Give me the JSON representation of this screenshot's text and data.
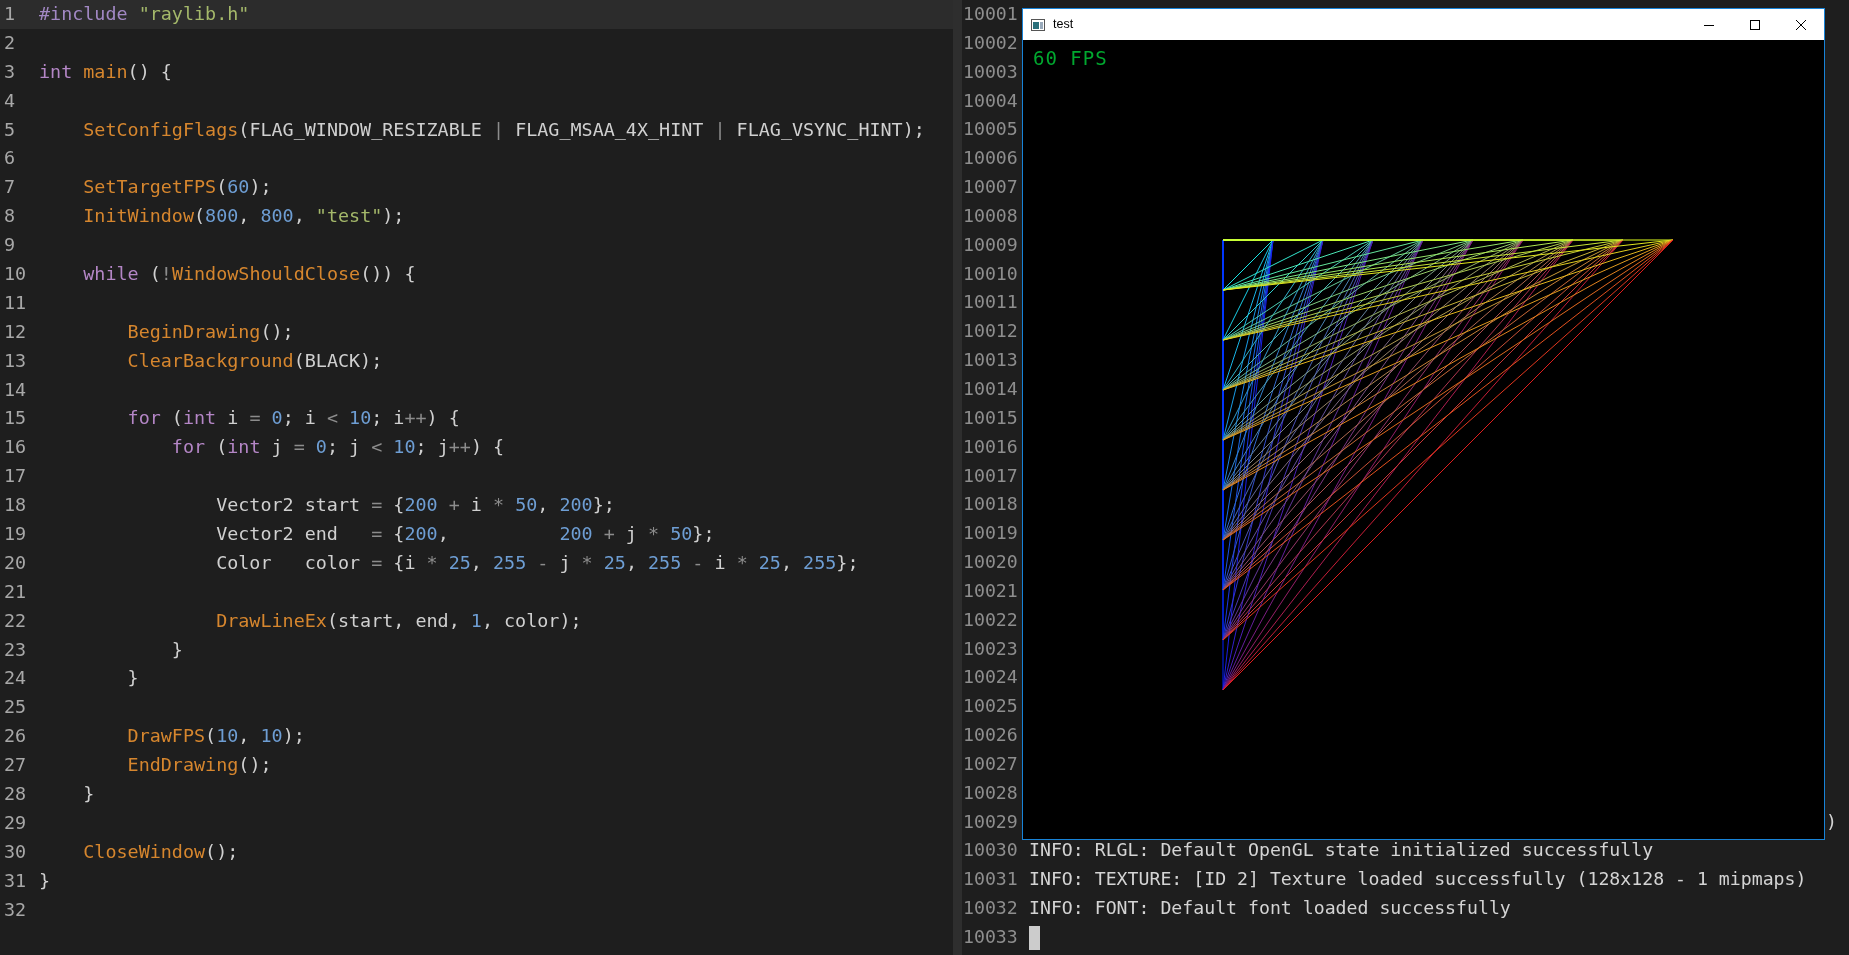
{
  "editor": {
    "lines": [
      {
        "number": "1",
        "current": true,
        "tokens": [
          {
            "kind": "preproc",
            "text": "#include"
          },
          {
            "kind": "string",
            "text": " \"raylib.h\""
          }
        ]
      },
      {
        "number": "2",
        "current": false
      },
      {
        "number": "3",
        "current": false,
        "tokens": [
          {
            "kind": "keyword",
            "text": "int"
          },
          {
            "kind": "func",
            "text": " main"
          },
          {
            "kind": "plain",
            "text": "() {"
          }
        ]
      },
      {
        "number": "4",
        "current": false
      },
      {
        "number": "5",
        "current": false,
        "tokens": [
          {
            "kind": "func",
            "text": "    SetConfigFlags"
          },
          {
            "kind": "plain",
            "text": "(FLAG_WINDOW_RESIZABLE "
          },
          {
            "kind": "op",
            "text": "|"
          },
          {
            "kind": "plain",
            "text": " FLAG_MSAA_4X_HINT "
          },
          {
            "kind": "op",
            "text": "|"
          },
          {
            "kind": "plain",
            "text": " FLAG_VSYNC_HINT);"
          }
        ]
      },
      {
        "number": "6",
        "current": false
      },
      {
        "number": "7",
        "current": false,
        "tokens": [
          {
            "kind": "func",
            "text": "    SetTargetFPS"
          },
          {
            "kind": "plain",
            "text": "("
          },
          {
            "kind": "number",
            "text": "60"
          },
          {
            "kind": "plain",
            "text": ");"
          }
        ]
      },
      {
        "number": "8",
        "current": false,
        "tokens": [
          {
            "kind": "func",
            "text": "    InitWindow"
          },
          {
            "kind": "plain",
            "text": "("
          },
          {
            "kind": "number",
            "text": "800"
          },
          {
            "kind": "plain",
            "text": ", "
          },
          {
            "kind": "number",
            "text": "800"
          },
          {
            "kind": "plain",
            "text": ", "
          },
          {
            "kind": "string",
            "text": "\"test\""
          },
          {
            "kind": "plain",
            "text": ");"
          }
        ]
      },
      {
        "number": "9",
        "current": false
      },
      {
        "number": "10",
        "current": false,
        "tokens": [
          {
            "kind": "keyword",
            "text": "    while"
          },
          {
            "kind": "plain",
            "text": " ("
          },
          {
            "kind": "op",
            "text": "!"
          },
          {
            "kind": "func",
            "text": "WindowShouldClose"
          },
          {
            "kind": "plain",
            "text": "()) {"
          }
        ]
      },
      {
        "number": "11",
        "current": false
      },
      {
        "number": "12",
        "current": false,
        "tokens": [
          {
            "kind": "func",
            "text": "        BeginDrawing"
          },
          {
            "kind": "plain",
            "text": "();"
          }
        ]
      },
      {
        "number": "13",
        "current": false,
        "tokens": [
          {
            "kind": "func",
            "text": "        ClearBackground"
          },
          {
            "kind": "plain",
            "text": "(BLACK);"
          }
        ]
      },
      {
        "number": "14",
        "current": false
      },
      {
        "number": "15",
        "current": false,
        "tokens": [
          {
            "kind": "keyword",
            "text": "        for"
          },
          {
            "kind": "plain",
            "text": " ("
          },
          {
            "kind": "keyword",
            "text": "int"
          },
          {
            "kind": "plain",
            "text": " i "
          },
          {
            "kind": "op",
            "text": "="
          },
          {
            "kind": "number",
            "text": " 0"
          },
          {
            "kind": "plain",
            "text": "; i "
          },
          {
            "kind": "op",
            "text": "<"
          },
          {
            "kind": "number",
            "text": " 10"
          },
          {
            "kind": "plain",
            "text": "; i"
          },
          {
            "kind": "op",
            "text": "++"
          },
          {
            "kind": "plain",
            "text": ") {"
          }
        ]
      },
      {
        "number": "16",
        "current": false,
        "tokens": [
          {
            "kind": "keyword",
            "text": "            for"
          },
          {
            "kind": "plain",
            "text": " ("
          },
          {
            "kind": "keyword",
            "text": "int"
          },
          {
            "kind": "plain",
            "text": " j "
          },
          {
            "kind": "op",
            "text": "="
          },
          {
            "kind": "number",
            "text": " 0"
          },
          {
            "kind": "plain",
            "text": "; j "
          },
          {
            "kind": "op",
            "text": "<"
          },
          {
            "kind": "number",
            "text": " 10"
          },
          {
            "kind": "plain",
            "text": "; j"
          },
          {
            "kind": "op",
            "text": "++"
          },
          {
            "kind": "plain",
            "text": ") {"
          }
        ]
      },
      {
        "number": "17",
        "current": false
      },
      {
        "number": "18",
        "current": false,
        "tokens": [
          {
            "kind": "plain",
            "text": "                Vector2 start "
          },
          {
            "kind": "op",
            "text": "="
          },
          {
            "kind": "plain",
            "text": " {"
          },
          {
            "kind": "number",
            "text": "200"
          },
          {
            "kind": "op",
            "text": " +"
          },
          {
            "kind": "plain",
            "text": " i "
          },
          {
            "kind": "op",
            "text": "*"
          },
          {
            "kind": "number",
            "text": " 50"
          },
          {
            "kind": "plain",
            "text": ", "
          },
          {
            "kind": "number",
            "text": "200"
          },
          {
            "kind": "plain",
            "text": "};"
          }
        ]
      },
      {
        "number": "19",
        "current": false,
        "tokens": [
          {
            "kind": "plain",
            "text": "                Vector2 end   "
          },
          {
            "kind": "op",
            "text": "="
          },
          {
            "kind": "plain",
            "text": " {"
          },
          {
            "kind": "number",
            "text": "200"
          },
          {
            "kind": "plain",
            "text": ",          "
          },
          {
            "kind": "number",
            "text": "200"
          },
          {
            "kind": "op",
            "text": " +"
          },
          {
            "kind": "plain",
            "text": " j "
          },
          {
            "kind": "op",
            "text": "*"
          },
          {
            "kind": "number",
            "text": " 50"
          },
          {
            "kind": "plain",
            "text": "};"
          }
        ]
      },
      {
        "number": "20",
        "current": false,
        "tokens": [
          {
            "kind": "plain",
            "text": "                Color   color "
          },
          {
            "kind": "op",
            "text": "="
          },
          {
            "kind": "plain",
            "text": " {i "
          },
          {
            "kind": "op",
            "text": "*"
          },
          {
            "kind": "number",
            "text": " 25"
          },
          {
            "kind": "plain",
            "text": ", "
          },
          {
            "kind": "number",
            "text": "255"
          },
          {
            "kind": "op",
            "text": " -"
          },
          {
            "kind": "plain",
            "text": " j "
          },
          {
            "kind": "op",
            "text": "*"
          },
          {
            "kind": "number",
            "text": " 25"
          },
          {
            "kind": "plain",
            "text": ", "
          },
          {
            "kind": "number",
            "text": "255"
          },
          {
            "kind": "op",
            "text": " -"
          },
          {
            "kind": "plain",
            "text": " i "
          },
          {
            "kind": "op",
            "text": "*"
          },
          {
            "kind": "number",
            "text": " 25"
          },
          {
            "kind": "plain",
            "text": ", "
          },
          {
            "kind": "number",
            "text": "255"
          },
          {
            "kind": "plain",
            "text": "};"
          }
        ]
      },
      {
        "number": "21",
        "current": false
      },
      {
        "number": "22",
        "current": false,
        "tokens": [
          {
            "kind": "func",
            "text": "                DrawLineEx"
          },
          {
            "kind": "plain",
            "text": "(start, end, "
          },
          {
            "kind": "number",
            "text": "1"
          },
          {
            "kind": "plain",
            "text": ", color);"
          }
        ]
      },
      {
        "number": "23",
        "current": false,
        "tokens": [
          {
            "kind": "plain",
            "text": "            }"
          }
        ]
      },
      {
        "number": "24",
        "current": false,
        "tokens": [
          {
            "kind": "plain",
            "text": "        }"
          }
        ]
      },
      {
        "number": "25",
        "current": false
      },
      {
        "number": "26",
        "current": false,
        "tokens": [
          {
            "kind": "func",
            "text": "        DrawFPS"
          },
          {
            "kind": "plain",
            "text": "("
          },
          {
            "kind": "number",
            "text": "10"
          },
          {
            "kind": "plain",
            "text": ", "
          },
          {
            "kind": "number",
            "text": "10"
          },
          {
            "kind": "plain",
            "text": ");"
          }
        ]
      },
      {
        "number": "27",
        "current": false,
        "tokens": [
          {
            "kind": "func",
            "text": "        EndDrawing"
          },
          {
            "kind": "plain",
            "text": "();"
          }
        ]
      },
      {
        "number": "28",
        "current": false,
        "tokens": [
          {
            "kind": "plain",
            "text": "    }"
          }
        ]
      },
      {
        "number": "29",
        "current": false
      },
      {
        "number": "30",
        "current": false,
        "tokens": [
          {
            "kind": "func",
            "text": "    CloseWindow"
          },
          {
            "kind": "plain",
            "text": "();"
          }
        ]
      },
      {
        "number": "31",
        "current": false,
        "tokens": [
          {
            "kind": "plain",
            "text": "}"
          }
        ]
      },
      {
        "number": "32",
        "current": false
      }
    ]
  },
  "terminal": {
    "lines": [
      {
        "number": "10001"
      },
      {
        "number": "10002"
      },
      {
        "number": "10003"
      },
      {
        "number": "10004"
      },
      {
        "number": "10005"
      },
      {
        "number": "10006"
      },
      {
        "number": "10007"
      },
      {
        "number": "10008"
      },
      {
        "number": "10009"
      },
      {
        "number": "10010"
      },
      {
        "number": "10011"
      },
      {
        "number": "10012"
      },
      {
        "number": "10013"
      },
      {
        "number": "10014"
      },
      {
        "number": "10015"
      },
      {
        "number": "10016"
      },
      {
        "number": "10017"
      },
      {
        "number": "10018"
      },
      {
        "number": "10019"
      },
      {
        "number": "10020"
      },
      {
        "number": "10021"
      },
      {
        "number": "10022"
      },
      {
        "number": "10023"
      },
      {
        "number": "10024"
      },
      {
        "number": "10025"
      },
      {
        "number": "10026"
      },
      {
        "number": "10027"
      },
      {
        "number": "10028"
      },
      {
        "number": "10029",
        "visible_tail": ")"
      },
      {
        "number": "10030",
        "text": "INFO: RLGL: Default OpenGL state initialized successfully"
      },
      {
        "number": "10031",
        "text": "INFO: TEXTURE: [ID 2] Texture loaded successfully (128x128 - 1 mipmaps)"
      },
      {
        "number": "10032",
        "text": "INFO: FONT: Default font loaded successfully"
      },
      {
        "number": "10033"
      }
    ]
  },
  "app_window": {
    "title": "test",
    "fps_text": "60 FPS"
  }
}
